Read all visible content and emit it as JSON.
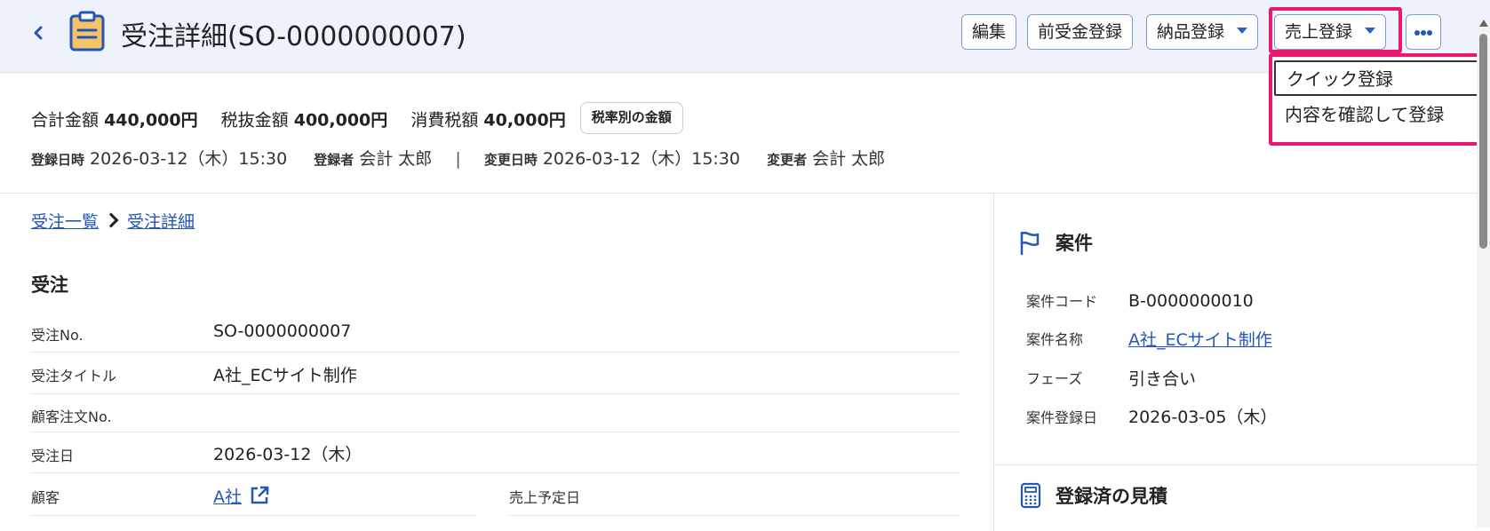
{
  "header": {
    "title": "受注詳細(SO-0000000007)",
    "buttons": {
      "edit": "編集",
      "advance_payment": "前受金登録",
      "delivery": "納品登録",
      "sales": "売上登録"
    },
    "sales_dropdown": {
      "items": [
        "クイック登録",
        "内容を確認して登録"
      ],
      "selected": "クイック登録"
    }
  },
  "summary": {
    "total_label": "合計金額",
    "total_value": "440,000円",
    "pretax_label": "税抜金額",
    "pretax_value": "400,000円",
    "tax_label": "消費税額",
    "tax_value": "40,000円",
    "tax_rate_button": "税率別の金額"
  },
  "meta": {
    "created_at_label": "登録日時",
    "created_at": "2026-03-12（木）15:30",
    "created_by_label": "登録者",
    "created_by": "会計 太郎",
    "separator": "|",
    "updated_at_label": "変更日時",
    "updated_at": "2026-03-12（木）15:30",
    "updated_by_label": "変更者",
    "updated_by": "会計 太郎"
  },
  "breadcrumb": {
    "list": "受注一覧",
    "detail": "受注詳細"
  },
  "order": {
    "section_title": "受注",
    "fields": {
      "no_label": "受注No.",
      "no": "SO-0000000007",
      "title_label": "受注タイトル",
      "title": "A社_ECサイト制作",
      "customer_po_label": "顧客注文No.",
      "customer_po": "",
      "date_label": "受注日",
      "date": "2026-03-12（木）",
      "customer_label": "顧客",
      "customer": "A社",
      "sales_date_label": "売上予定日",
      "sales_date": ""
    }
  },
  "project": {
    "section_title": "案件",
    "fields": {
      "code_label": "案件コード",
      "code": "B-0000000010",
      "name_label": "案件名称",
      "name": "A社_ECサイト制作",
      "phase_label": "フェーズ",
      "phase": "引き合い",
      "created_label": "案件登録日",
      "created": "2026-03-05（木）"
    }
  },
  "estimates": {
    "section_title": "登録済の見積"
  },
  "colors": {
    "header_bg": "#eef3fb",
    "accent": "#2456b8",
    "highlight": "#e8196f",
    "title_icon": "#f5c469"
  },
  "icons": {
    "back": "chevron-left-icon",
    "title": "clipboard-icon",
    "more": "more-horizontal-icon",
    "external": "external-link-icon",
    "project": "flag-icon",
    "estimates": "calculator-icon"
  }
}
